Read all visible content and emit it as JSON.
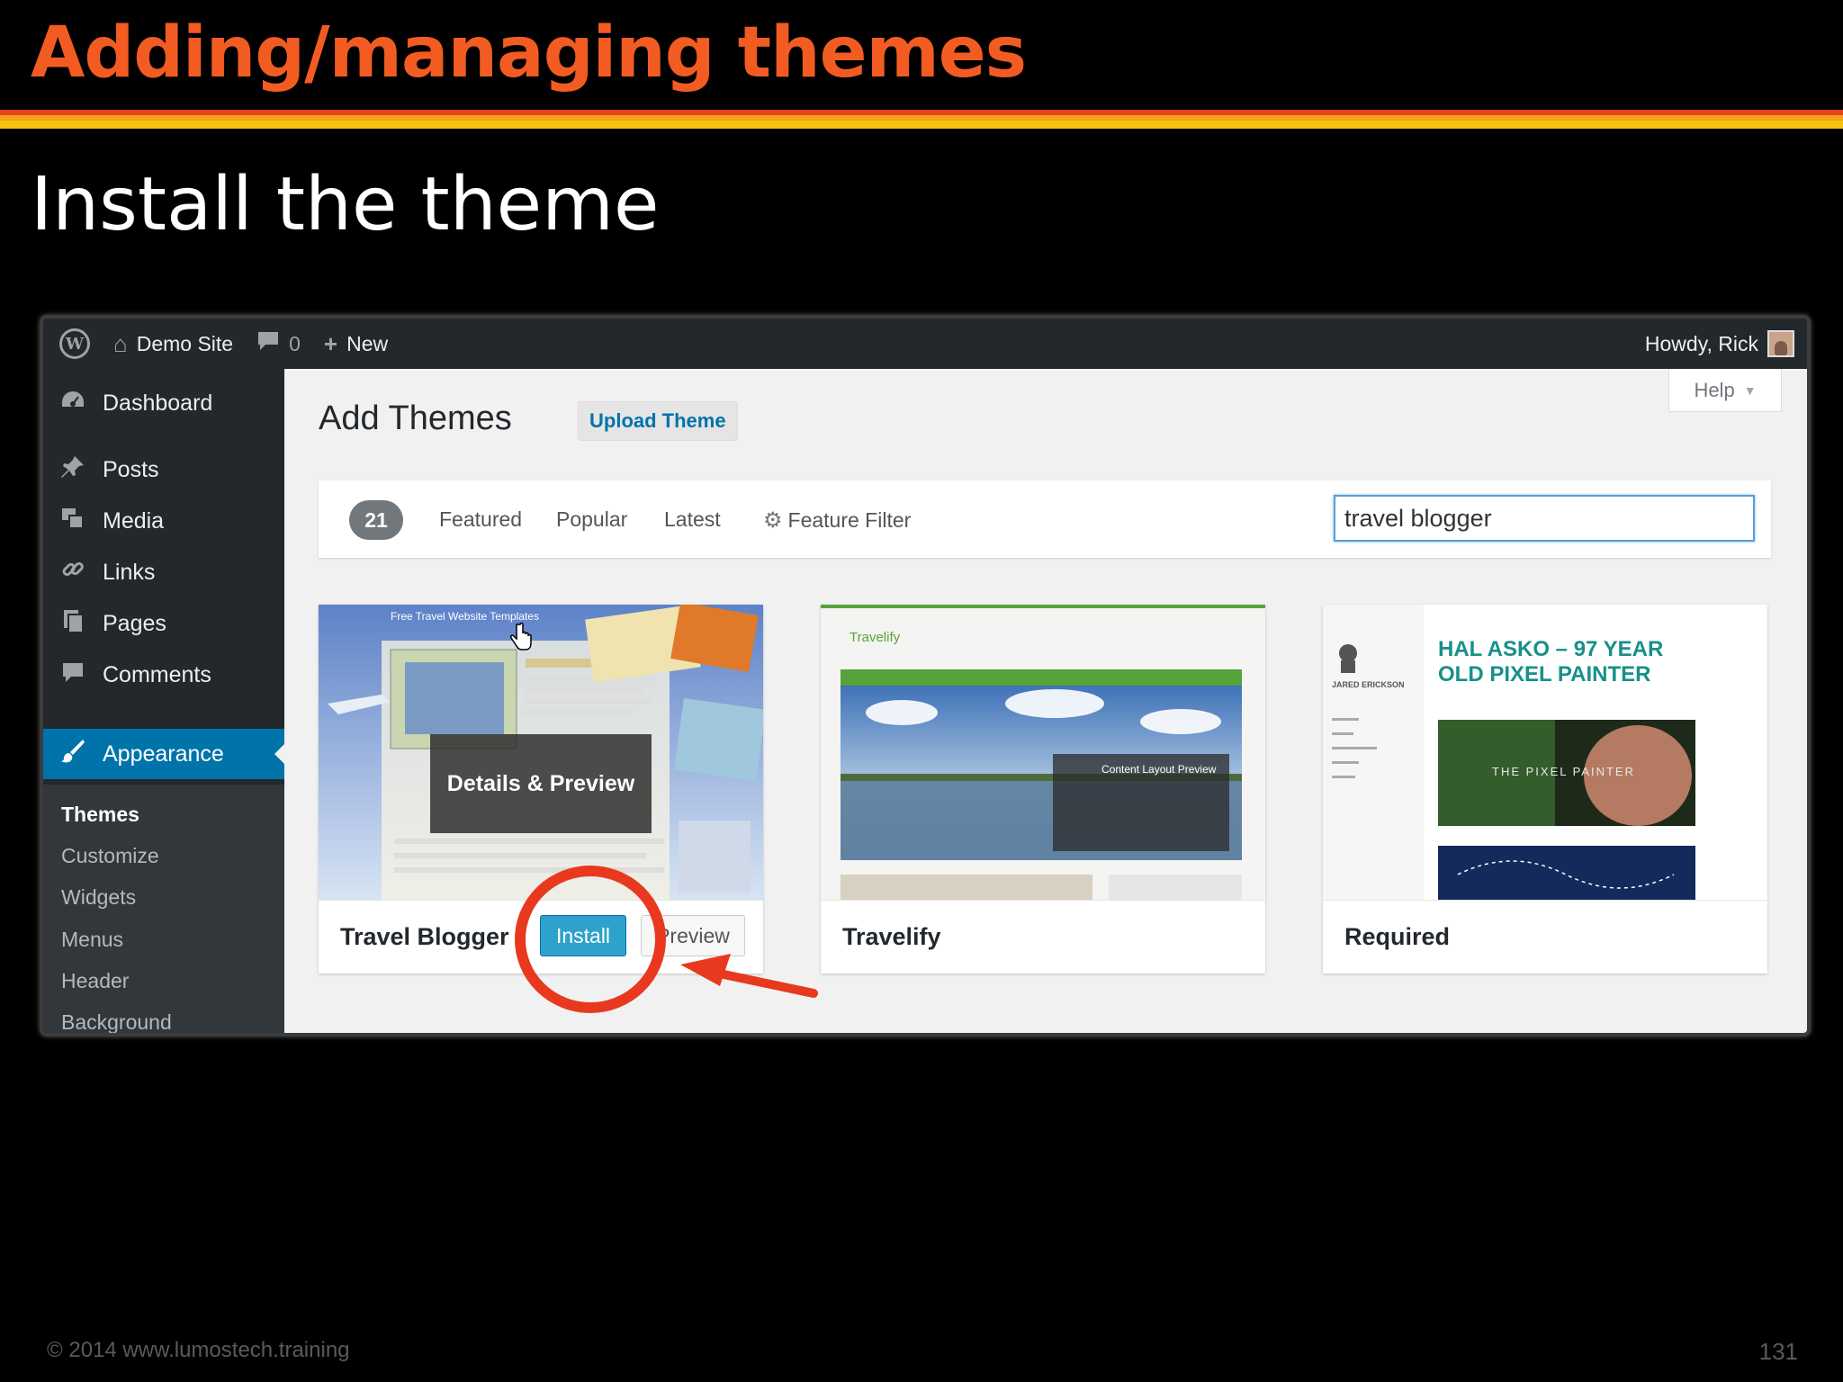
{
  "slide": {
    "title": "Adding/managing themes",
    "subtitle": "Install the theme",
    "footer": "© 2014  www.lumostech.training",
    "page_number": "131"
  },
  "adminbar": {
    "site_name": "Demo Site",
    "comments_count": "0",
    "new_label": "New",
    "greeting": "Howdy, Rick"
  },
  "sidebar": {
    "items": [
      {
        "label": "Dashboard",
        "icon": "dashboard-icon"
      },
      {
        "label": "Posts",
        "icon": "pin-icon"
      },
      {
        "label": "Media",
        "icon": "media-icon"
      },
      {
        "label": "Links",
        "icon": "link-icon"
      },
      {
        "label": "Pages",
        "icon": "pages-icon"
      },
      {
        "label": "Comments",
        "icon": "comment-icon"
      },
      {
        "label": "Appearance",
        "icon": "paintbrush-icon"
      }
    ],
    "submenu": [
      "Themes",
      "Customize",
      "Widgets",
      "Menus",
      "Header",
      "Background"
    ]
  },
  "main": {
    "help_label": "Help",
    "page_title": "Add Themes",
    "upload_label": "Upload Theme",
    "filter": {
      "count": "21",
      "links": [
        "Featured",
        "Popular",
        "Latest"
      ],
      "feature_filter": "Feature Filter"
    },
    "search_value": "travel blogger"
  },
  "themes": [
    {
      "name": "Travel Blogger",
      "overlay": "Details & Preview",
      "install_label": "Install",
      "preview_label": "Preview",
      "mock_banner": "Free Travel Website Templates"
    },
    {
      "name": "Travelify",
      "mock_logo": "Travelify",
      "mock_caption": "Content Layout Preview"
    },
    {
      "name": "Required",
      "mock_author": "JARED ERICKSON",
      "mock_heading_1": "HAL ASKO – 97 YEAR",
      "mock_heading_2": "OLD PIXEL PAINTER",
      "mock_image_text": "THE PIXEL PAINTER"
    }
  ],
  "colors": {
    "title_orange": "#f25c22",
    "wp_admin_dark": "#23282d",
    "wp_blue": "#0073aa",
    "install_blue": "#2ea2cc",
    "annotation_red": "#e8391e"
  }
}
